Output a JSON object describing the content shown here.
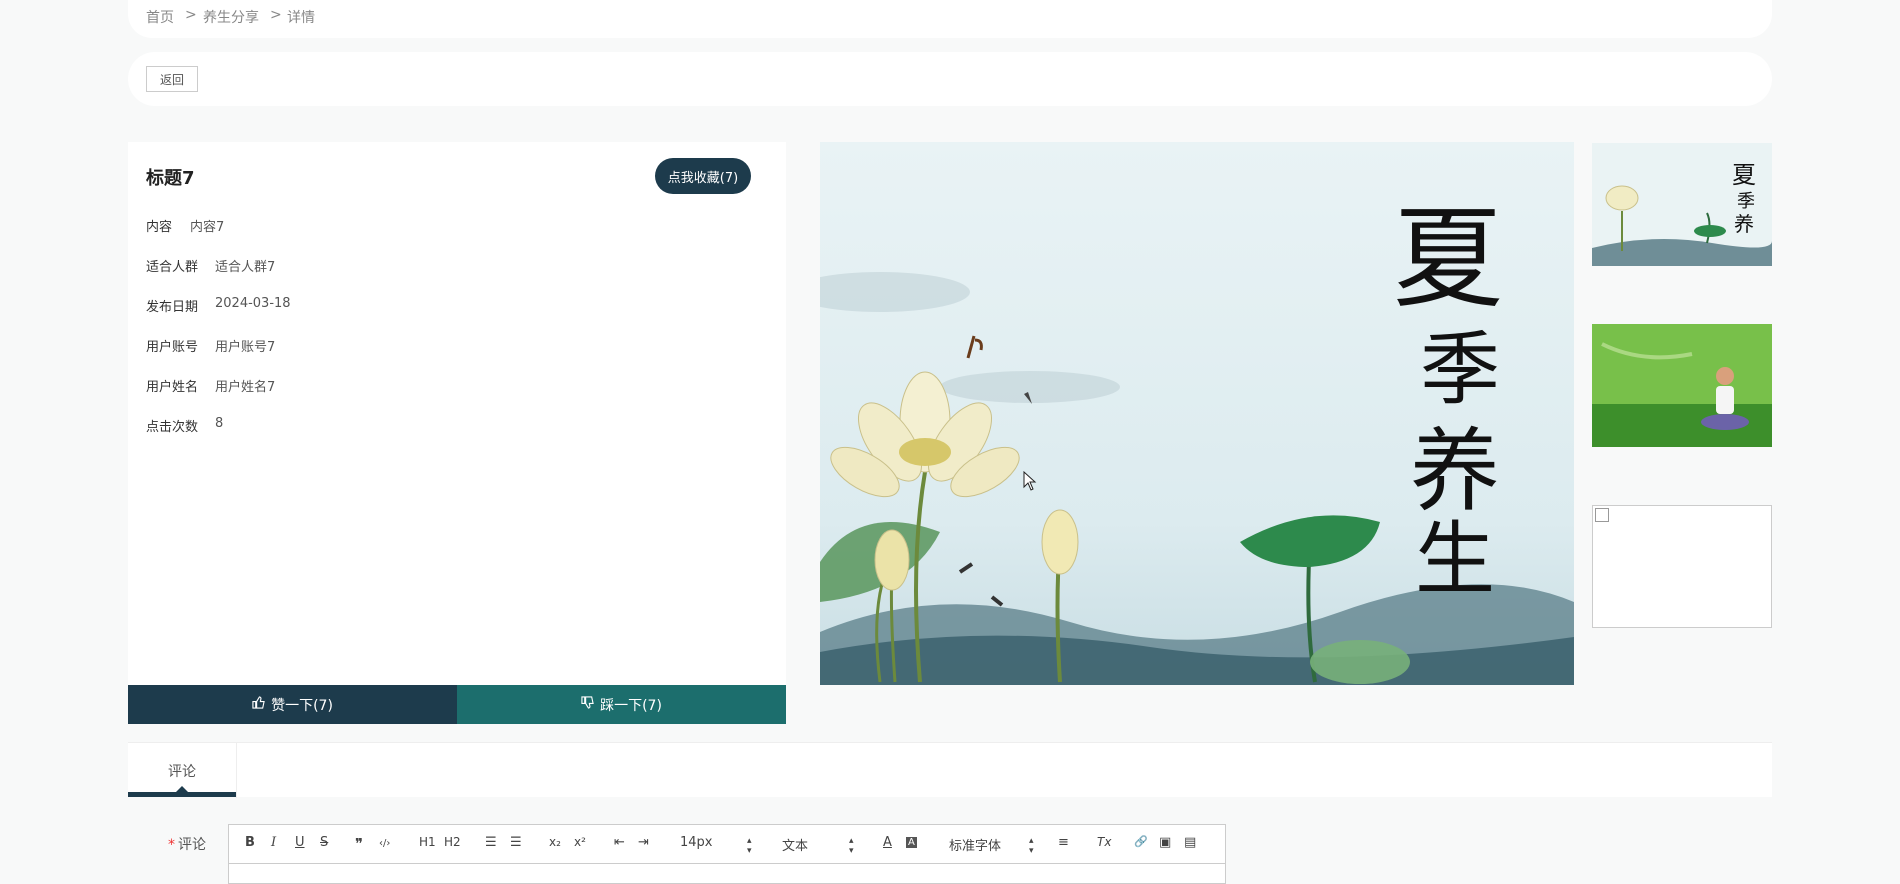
{
  "breadcrumb": {
    "items": [
      "首页",
      "养生分享",
      "详情"
    ],
    "separator": ">"
  },
  "back_label": "返回",
  "detail": {
    "title": "标题7",
    "favorite_label": "点我收藏(7)",
    "fields": [
      {
        "label": "内容",
        "value": "内容7"
      },
      {
        "label": "适合人群",
        "value": "适合人群7"
      },
      {
        "label": "发布日期",
        "value": "2024-03-18"
      },
      {
        "label": "用户账号",
        "value": "用户账号7"
      },
      {
        "label": "用户姓名",
        "value": "用户姓名7"
      },
      {
        "label": "点击次数",
        "value": "8"
      }
    ],
    "like_label": "赞一下(7)",
    "dislike_label": "踩一下(7)"
  },
  "main_image": {
    "calligraphy": [
      "夏",
      "季",
      "养",
      "生"
    ]
  },
  "tabs": [
    {
      "label": "评论",
      "active": true
    }
  ],
  "comment": {
    "required_mark": "*",
    "label": "评论",
    "toolbar": {
      "bold": "B",
      "italic": "I",
      "underline": "U",
      "strike": "S",
      "quote": "❞",
      "code": "‹/›",
      "h1": "H1",
      "h2": "H2",
      "ol": "☰",
      "ul": "☰",
      "sub": "x₂",
      "sup": "x²",
      "outdent": "⇤",
      "indent": "⇥",
      "size": "14px",
      "header": "文本",
      "font_color": "A",
      "bg_color": "A",
      "font": "标准字体",
      "align": "≡",
      "clean": "Tx",
      "link": "🔗",
      "image": "▣",
      "video": "▤"
    }
  },
  "colors": {
    "primary": "#1d3b4c",
    "secondary": "#1c6e6d",
    "required": "#e33"
  }
}
